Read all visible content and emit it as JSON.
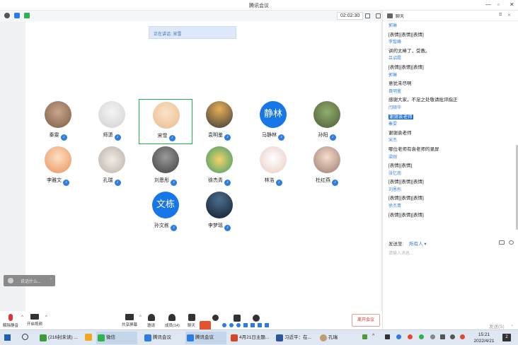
{
  "window": {
    "title": "腾讯会议",
    "minimize": "—",
    "maximize": "▫",
    "close": "✕"
  },
  "toolbar": {
    "timer": "02:02:30"
  },
  "speaking_banner": "正在讲话: 宋雪",
  "participants": [
    {
      "name": "秦雯",
      "mic": "on"
    },
    {
      "name": "师潇",
      "mic": "on"
    },
    {
      "name": "宋雪",
      "mic": "on",
      "speaking": true
    },
    {
      "name": "袁明鉴",
      "mic": "on"
    },
    {
      "name": "马静林",
      "mic": "on",
      "avatar_text": "静林"
    },
    {
      "name": "孙阳",
      "mic": "on"
    },
    {
      "name": "李雅文",
      "mic": "on"
    },
    {
      "name": "孔瑞",
      "mic": "on"
    },
    {
      "name": "刘恩彤",
      "mic": "on"
    },
    {
      "name": "徐杰青",
      "mic": "on"
    },
    {
      "name": "林浩",
      "mic": "on"
    },
    {
      "name": "杜红燕",
      "mic": "on"
    },
    {
      "name": "孙文栋",
      "mic": "on",
      "avatar_text": "文栋"
    },
    {
      "name": "李梦瑶",
      "mic": "on"
    }
  ],
  "mini_toolbar": {
    "label": "说话什么..."
  },
  "bottom": {
    "mute": "解除静音",
    "video": "开启视频",
    "share": "共享屏幕",
    "invite": "邀请",
    "members": "成员(14)",
    "chat": "聊天",
    "leave": "离开会议"
  },
  "chat": {
    "header": "聊天",
    "messages": [
      {
        "sender": "郭琳",
        "text": "[表情][表情][表情]"
      },
      {
        "sender": "李智峰",
        "text": "讲的太棒了，受教。"
      },
      {
        "sender": "吕诏霞",
        "text": "[表情][表情][表情]"
      },
      {
        "sender": "郭琳",
        "text": "意犹未尽啊"
      },
      {
        "sender": "袁明鉴",
        "text": "感谢大家，不足之处敬请批评指正"
      },
      {
        "sender": "闫硕华",
        "text": "谢谢袁老师",
        "highlight": true
      },
      {
        "sender": "秦雯",
        "text": "谢谢袁老师"
      },
      {
        "sender": "宋杰",
        "text": "哪位老师有袁老师的录屏"
      },
      {
        "sender": "梁刚",
        "text": "[表情][表情]"
      },
      {
        "sender": "张忆南",
        "text": "[表情][表情][表情]"
      },
      {
        "sender": "刘恩彤",
        "text": "[表情][表情][表情]"
      },
      {
        "sender": "徐杰青",
        "text": "[表情][表情][表情]"
      }
    ],
    "send_to_label": "发送至:",
    "send_to_value": "所有人 ▾",
    "input_placeholder": "请输入消息...",
    "send_button": "发送(S)"
  },
  "taskbar": {
    "apps": [
      {
        "label": "(216封未读) ..."
      },
      {
        "label": "微信"
      },
      {
        "label": "腾讯会议"
      },
      {
        "label": "腾讯会议"
      },
      {
        "label": "4月21日主题..."
      },
      {
        "label": "习近平：在..."
      },
      {
        "label": "孔瑞"
      }
    ],
    "time": "15:21",
    "date": "2022/4/21",
    "notif": "2"
  },
  "colors": {
    "accent": "#1877e8",
    "active_border": "#23b04a",
    "leave": "#d33333"
  }
}
